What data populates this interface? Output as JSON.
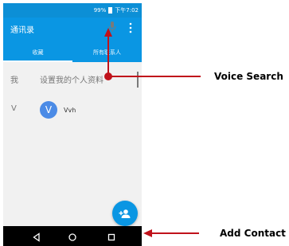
{
  "status_bar": {
    "battery": "99%",
    "time": "下午7:02"
  },
  "app_bar": {
    "title": "通讯录",
    "mic_icon": "mic-icon",
    "more_icon": "more-vert-icon"
  },
  "tabs": [
    {
      "label": "收藏",
      "active": true
    },
    {
      "label": "所有联系人",
      "active": false
    }
  ],
  "profile": {
    "letter": "我",
    "text": "设置我的个人资料"
  },
  "contacts": [
    {
      "section": "V",
      "avatar_letter": "V",
      "name": "Vvh"
    }
  ],
  "fab": {
    "icon": "add-contact-icon"
  },
  "nav": {
    "back_icon": "back-triangle-icon",
    "home_icon": "home-circle-icon",
    "recents_icon": "recents-square-icon"
  },
  "annotations": {
    "voice_search": "Voice Search",
    "add_contact": "Add Contact"
  },
  "colors": {
    "primary": "#0a96e3",
    "annotation": "#c0121b"
  }
}
